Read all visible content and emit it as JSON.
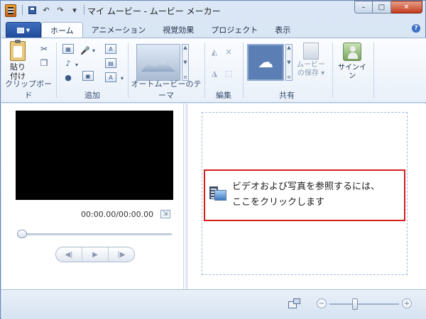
{
  "window": {
    "title": "マイ ムービー - ムービー メーカー",
    "controls": {
      "minimize": "–",
      "maximize": "□",
      "close": "✕"
    }
  },
  "quick_access": {
    "undo": "↶",
    "redo": "↷",
    "customize": "▾"
  },
  "ribbon": {
    "tabs": [
      "ホーム",
      "アニメーション",
      "視覚効果",
      "プロジェクト",
      "表示"
    ],
    "active_tab": "ホーム",
    "help": "?",
    "groups": {
      "clipboard": {
        "label": "クリップボード",
        "paste_label": "貼り\n付け"
      },
      "add": {
        "label": "追加"
      },
      "automovie": {
        "label": "オートムービーのテーマ"
      },
      "edit": {
        "label": "編集"
      },
      "share": {
        "label": "共有",
        "save_movie_label": "ムービー\nの保存 ▾",
        "cloud_glyph": "☁"
      },
      "signin": {
        "label": "サインイン"
      }
    }
  },
  "preview": {
    "timecode": "00:00.00/00:00.00",
    "fullscreen_glyph": "⇲",
    "controls": {
      "prev": "◀|",
      "play": "▶",
      "next": "|▶"
    },
    "seek_position": 0
  },
  "storyboard": {
    "browse_text_line1": "ビデオおよび写真を参照するには、",
    "browse_text_line2": "ここをクリックします"
  },
  "statusbar": {
    "zoom_out": "−",
    "zoom_in": "+",
    "zoom_level": 0.35
  },
  "colors": {
    "accent": "#1f4a98",
    "highlight_border": "#d41f1f"
  }
}
